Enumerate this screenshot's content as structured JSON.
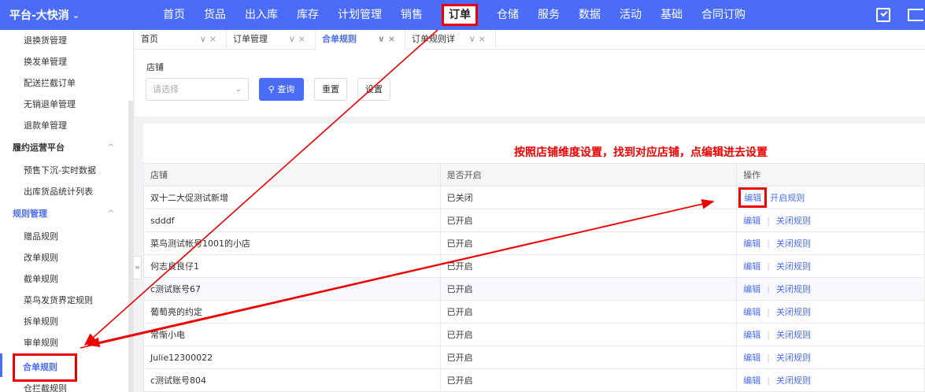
{
  "app": {
    "brand": "平台-大快消"
  },
  "topnav": [
    "首页",
    "货品",
    "出入库",
    "库存",
    "计划管理",
    "销售",
    "订单",
    "仓储",
    "服务",
    "数据",
    "活动",
    "基础",
    "合同订购"
  ],
  "topnav_active": "订单",
  "sidebar": {
    "items_top": [
      "退换货管理",
      "换发单管理",
      "配送拦截订单",
      "无销退单管理",
      "退款单管理"
    ],
    "group1": "履约运营平台",
    "group1_items": [
      "预售下沉-实时数据",
      "出库货品统计列表"
    ],
    "group2": "规则管理",
    "group2_items": [
      "赠品规则",
      "改单规则",
      "截单规则",
      "菜鸟发货界定规则",
      "拆单规则",
      "审单规则"
    ],
    "selected": "合单规则",
    "after_selected": "仓拦截规则"
  },
  "tabs": [
    "首页",
    "订单管理",
    "合单规则",
    "订单规则详情"
  ],
  "tab_active": "合单规则",
  "filter": {
    "label": "店铺",
    "placeholder": "请选择",
    "search": "查询",
    "reset": "重置",
    "settings": "设置"
  },
  "annotation": "按照店铺维度设置，找到对应店铺，点编辑进去设置",
  "table": {
    "headers": [
      "店铺",
      "是否开启",
      "操作"
    ],
    "rows": [
      {
        "shop": "双十二大促测试新增",
        "status": "已关闭",
        "edit": "编辑",
        "action": "开启规则"
      },
      {
        "shop": "sdddf",
        "status": "已开启",
        "edit": "编辑",
        "action": "关闭规则"
      },
      {
        "shop": "菜鸟测试帐号1001的小店",
        "status": "已开启",
        "edit": "编辑",
        "action": "关闭规则"
      },
      {
        "shop": "何志良良仔1",
        "status": "已开启",
        "edit": "编辑",
        "action": "关闭规则"
      },
      {
        "shop": "c测试账号67",
        "status": "已开启",
        "edit": "编辑",
        "action": "关闭规则"
      },
      {
        "shop": "葡萄亮的约定",
        "status": "已开启",
        "edit": "编辑",
        "action": "关闭规则"
      },
      {
        "shop": "常惭小电",
        "status": "已开启",
        "edit": "编辑",
        "action": "关闭规则"
      },
      {
        "shop": "Julie12300022",
        "status": "已开启",
        "edit": "编辑",
        "action": "关闭规则"
      },
      {
        "shop": "c测试账号804",
        "status": "已开启",
        "edit": "编辑",
        "action": "关闭规则"
      }
    ]
  },
  "colors": {
    "primary": "#4a6cf7",
    "highlight": "#e00000"
  }
}
